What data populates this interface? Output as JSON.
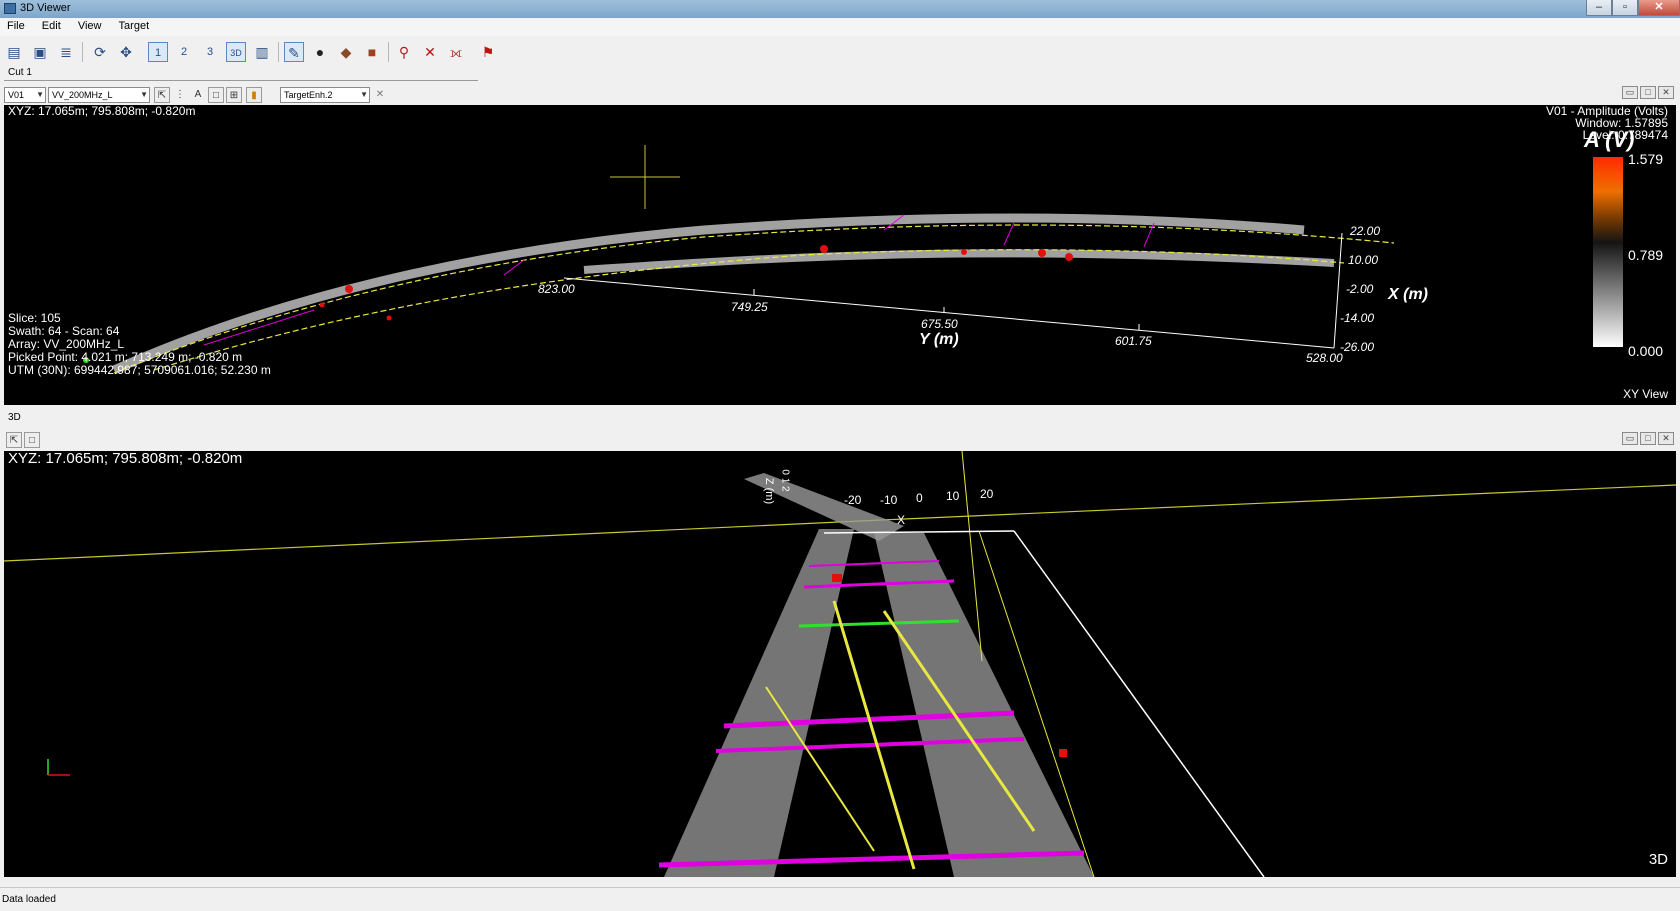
{
  "window": {
    "title": "3D Viewer"
  },
  "window_buttons": {
    "minimize": "–",
    "maximize": "▫",
    "close": "✕"
  },
  "menu": [
    "File",
    "Edit",
    "View",
    "Target"
  ],
  "toolbar": {
    "buttons": [
      {
        "name": "open-data-icon",
        "glyph": "▤"
      },
      {
        "name": "camera-icon",
        "glyph": "▣"
      },
      {
        "name": "layers-icon",
        "glyph": "≣"
      },
      {
        "name": "refresh-icon",
        "glyph": "⟳"
      },
      {
        "name": "pan-icon",
        "glyph": "✥"
      },
      {
        "name": "view-1-icon",
        "glyph": "1"
      },
      {
        "name": "view-2-icon",
        "glyph": "2"
      },
      {
        "name": "view-3-icon",
        "glyph": "3"
      },
      {
        "name": "view-3d-icon",
        "glyph": "3D"
      },
      {
        "name": "map-icon",
        "glyph": "▥"
      },
      {
        "name": "pick-icon",
        "glyph": "✎"
      },
      {
        "name": "cylinder-icon",
        "glyph": "●"
      },
      {
        "name": "shape-icon",
        "glyph": "◆"
      },
      {
        "name": "block-icon",
        "glyph": "■"
      },
      {
        "name": "target-icon",
        "glyph": "⚲"
      },
      {
        "name": "delete-icon",
        "glyph": "✕"
      },
      {
        "name": "link-icon",
        "glyph": "⟗"
      },
      {
        "name": "marker-icon",
        "glyph": "⚑"
      }
    ]
  },
  "cut": {
    "label": "Cut 1"
  },
  "top_panel": {
    "channel_select": "V01",
    "array_select": "VV_200MHz_L",
    "filter_select": "TargetEnh.2",
    "xyz": "XYZ:  17.065m; 795.808m; -0.820m",
    "colorbar": {
      "header_line1": "V01 - Amplitude (Volts)",
      "header_line2": "Window: 1.57895",
      "header_line3": "Level: 0.789474",
      "title": "A (V)",
      "max": "1.579",
      "mid": "0.789",
      "min": "0.000"
    },
    "info": {
      "slice": "Slice:  105",
      "swath": "Swath: 64 - Scan: 64",
      "array": "Array: VV_200MHz_L",
      "picked": "Picked Point:  4.021 m; 713.249 m; -0.820 m",
      "utm": "UTM (30N):  699442.987; 5709061.016; 52.230 m"
    },
    "y_axis_ticks": [
      "823.00",
      "749.25",
      "675.50",
      "601.75",
      "528.00"
    ],
    "y_axis_label": "Y (m)",
    "x_axis_ticks": [
      "22.00",
      "10.00",
      "-2.00",
      "-14.00",
      "-26.00"
    ],
    "x_axis_label": "X (m)",
    "view_name": "XY View"
  },
  "bottom_panel": {
    "section_label": "3D",
    "xyz": "XYZ:  17.065m; 795.808m; -0.820m",
    "axis_ticks": [
      "-20",
      "-10",
      "0",
      "10",
      "20"
    ],
    "axis_label_x": "X",
    "axis_label_z": "Z (m)",
    "axis_z_ticks": "0 1 2",
    "view_name": "3D"
  },
  "status": {
    "text": "Data loaded"
  },
  "colors": {
    "path_magenta": "#e000e0",
    "path_yellow": "#e8e840",
    "path_green": "#30e030",
    "marker_red": "#e01010"
  }
}
